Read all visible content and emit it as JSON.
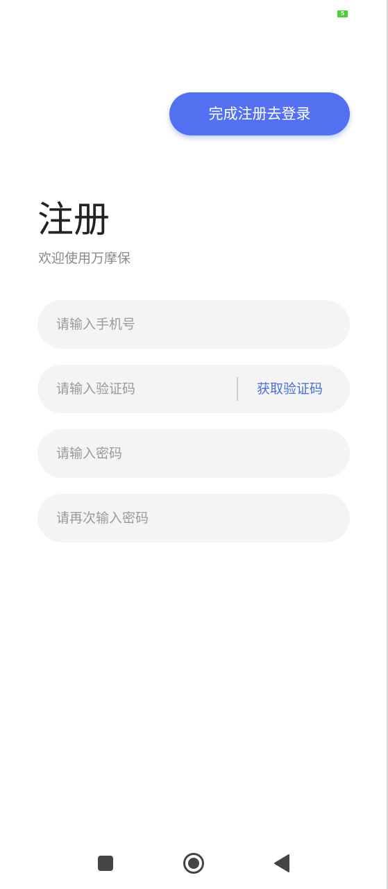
{
  "status_bar": {
    "battery_label": "5",
    "battery_color": "#4cd137"
  },
  "header": {
    "go_login_label": "完成注册去登录"
  },
  "title": {
    "main": "注册",
    "subtitle": "欢迎使用万摩保"
  },
  "form": {
    "phone_placeholder": "请输入手机号",
    "phone_value": "",
    "code_placeholder": "请输入验证码",
    "code_value": "",
    "get_code_label": "获取验证码",
    "password_placeholder": "请输入密码",
    "password_value": "",
    "confirm_password_placeholder": "请再次输入密码",
    "confirm_password_value": ""
  },
  "nav_bar": {
    "icons": [
      "recent-apps-icon",
      "home-icon",
      "back-icon"
    ]
  },
  "colors": {
    "accent": "#5370f0",
    "link": "#4a6fd8",
    "input_bg": "#f4f4f4"
  }
}
